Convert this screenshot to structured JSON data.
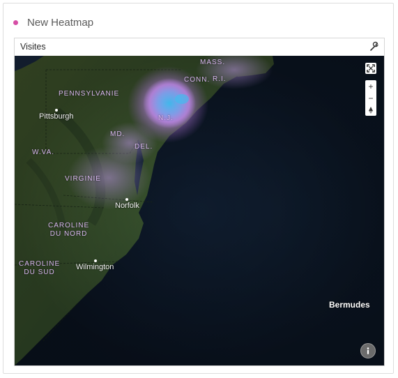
{
  "widget": {
    "title": "New Heatmap",
    "status_dot_color": "#d64ea6"
  },
  "panel": {
    "label": "Visites",
    "settings_icon": "wrench-icon"
  },
  "map": {
    "state_labels": {
      "mass": "MASS.",
      "conn": "CONN.",
      "ri": "R.I.",
      "pennsylvanie": "PENNSYLVANIE",
      "nj": "N.J.",
      "md": "MD.",
      "del": "DEL.",
      "wva": "W.VA.",
      "virginie": "VIRGINIE",
      "caroline_nord_1": "CAROLINE",
      "caroline_nord_2": "DU NORD",
      "caroline_sud_1": "CAROLINE",
      "caroline_sud_2": "DU SUD"
    },
    "city_labels": {
      "pittsburgh": "Pittsburgh",
      "norfolk": "Norfolk",
      "wilmington": "Wilmington"
    },
    "island_labels": {
      "bermudes": "Bermudes"
    },
    "controls": {
      "fullscreen_icon": "fullscreen-icon",
      "zoom_in": "+",
      "zoom_out": "−",
      "compass_icon": "compass-icon",
      "info_icon": "info-icon"
    },
    "colors": {
      "land": "#3f5a2c",
      "ocean": "#0f1b2c",
      "heat_core": "#3fb8e8",
      "heat_glow": "#c98be8"
    }
  }
}
